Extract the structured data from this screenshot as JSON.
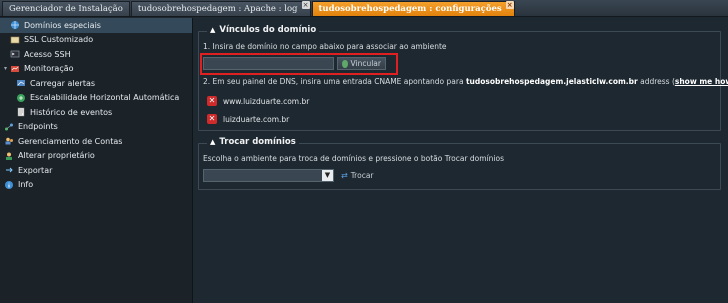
{
  "tabs": [
    {
      "label": "Gerenciador de Instalação",
      "active": false,
      "closable": false
    },
    {
      "label": "tudosobrehospedagem : Apache : log",
      "active": false,
      "closable": true
    },
    {
      "label": "tudosobrehospedagem : configurações",
      "active": true,
      "closable": true
    }
  ],
  "close_glyph": "×",
  "sidebar": {
    "items": [
      {
        "label": "Domínios especiais",
        "icon": "globe-icon",
        "indent": 1,
        "selected": true
      },
      {
        "label": "SSL Customizado",
        "icon": "certificate-icon",
        "indent": 1,
        "selected": false
      },
      {
        "label": "Acesso SSH",
        "icon": "terminal-icon",
        "indent": 1,
        "selected": false
      },
      {
        "label": "Monitoração",
        "icon": "monitor-icon",
        "indent": 0,
        "expanded": true,
        "selected": false
      },
      {
        "label": "Carregar alertas",
        "icon": "alert-icon",
        "indent": 2,
        "selected": false
      },
      {
        "label": "Escalabilidade Horizontal Automática",
        "icon": "scale-icon",
        "indent": 2,
        "selected": false
      },
      {
        "label": "Histórico de eventos",
        "icon": "history-icon",
        "indent": 2,
        "selected": false
      },
      {
        "label": "Endpoints",
        "icon": "endpoints-icon",
        "indent": 0,
        "selected": false
      },
      {
        "label": "Gerenciamento de Contas",
        "icon": "users-icon",
        "indent": 0,
        "selected": false
      },
      {
        "label": "Alterar proprietário",
        "icon": "owner-icon",
        "indent": 0,
        "selected": false
      },
      {
        "label": "Exportar",
        "icon": "export-icon",
        "indent": 0,
        "selected": false
      },
      {
        "label": "Info",
        "icon": "info-icon",
        "indent": 0,
        "selected": false
      }
    ]
  },
  "bindings": {
    "title": "Vínculos do domínio",
    "step1": "1. Insira de domínio no campo abaixo para associar ao ambiente",
    "domain_input_value": "",
    "bind_button": "Vincular",
    "step2_prefix": "2. Em seu painel de DNS, insira uma entrada CNAME apontando para",
    "step2_host": "tudosobrehospedagem.jelasticlw.com.br",
    "step2_suffix": "address",
    "show_me_how": "show me how",
    "domains": [
      "www.luizduarte.com.br",
      "luizduarte.com.br"
    ]
  },
  "swap": {
    "title": "Trocar domínios",
    "description": "Escolha o ambiente para troca de domínios e pressione o botão Trocar domínios",
    "select_value": "",
    "swap_button": "Trocar"
  },
  "colors": {
    "active_tab": "#f08e1a",
    "highlight": "#e02020",
    "remove_icon": "#d12a2a",
    "selected_row": "#34495a"
  }
}
